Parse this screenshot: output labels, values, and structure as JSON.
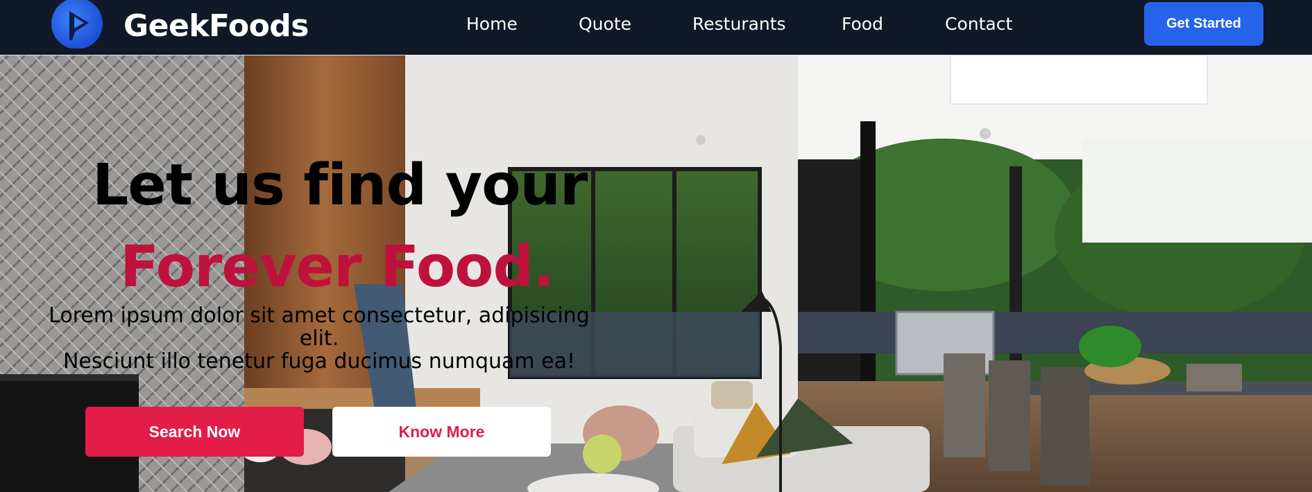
{
  "navbar": {
    "brand": "GeekFoods",
    "logo_icon": "play-logo-icon",
    "links": [
      "Home",
      "Quote",
      "Resturants",
      "Food",
      "Contact"
    ],
    "cta_label": "Get Started"
  },
  "hero": {
    "headline_line1": "Let us find your",
    "headline_line2": "Forever Food.",
    "lead_line1": "Lorem ipsum dolor sit amet consectetur, adipisicing elit.",
    "lead_line2": "Nesciunt illo tenetur fuga ducimus numquam ea!",
    "primary_button": "Search Now",
    "secondary_button": "Know More",
    "background_image": "modern living room with patio photo"
  },
  "colors": {
    "nav_bg": "#111827",
    "cta_blue": "#2563eb",
    "accent_red": "#e11d48",
    "headline_red": "#be123c"
  }
}
